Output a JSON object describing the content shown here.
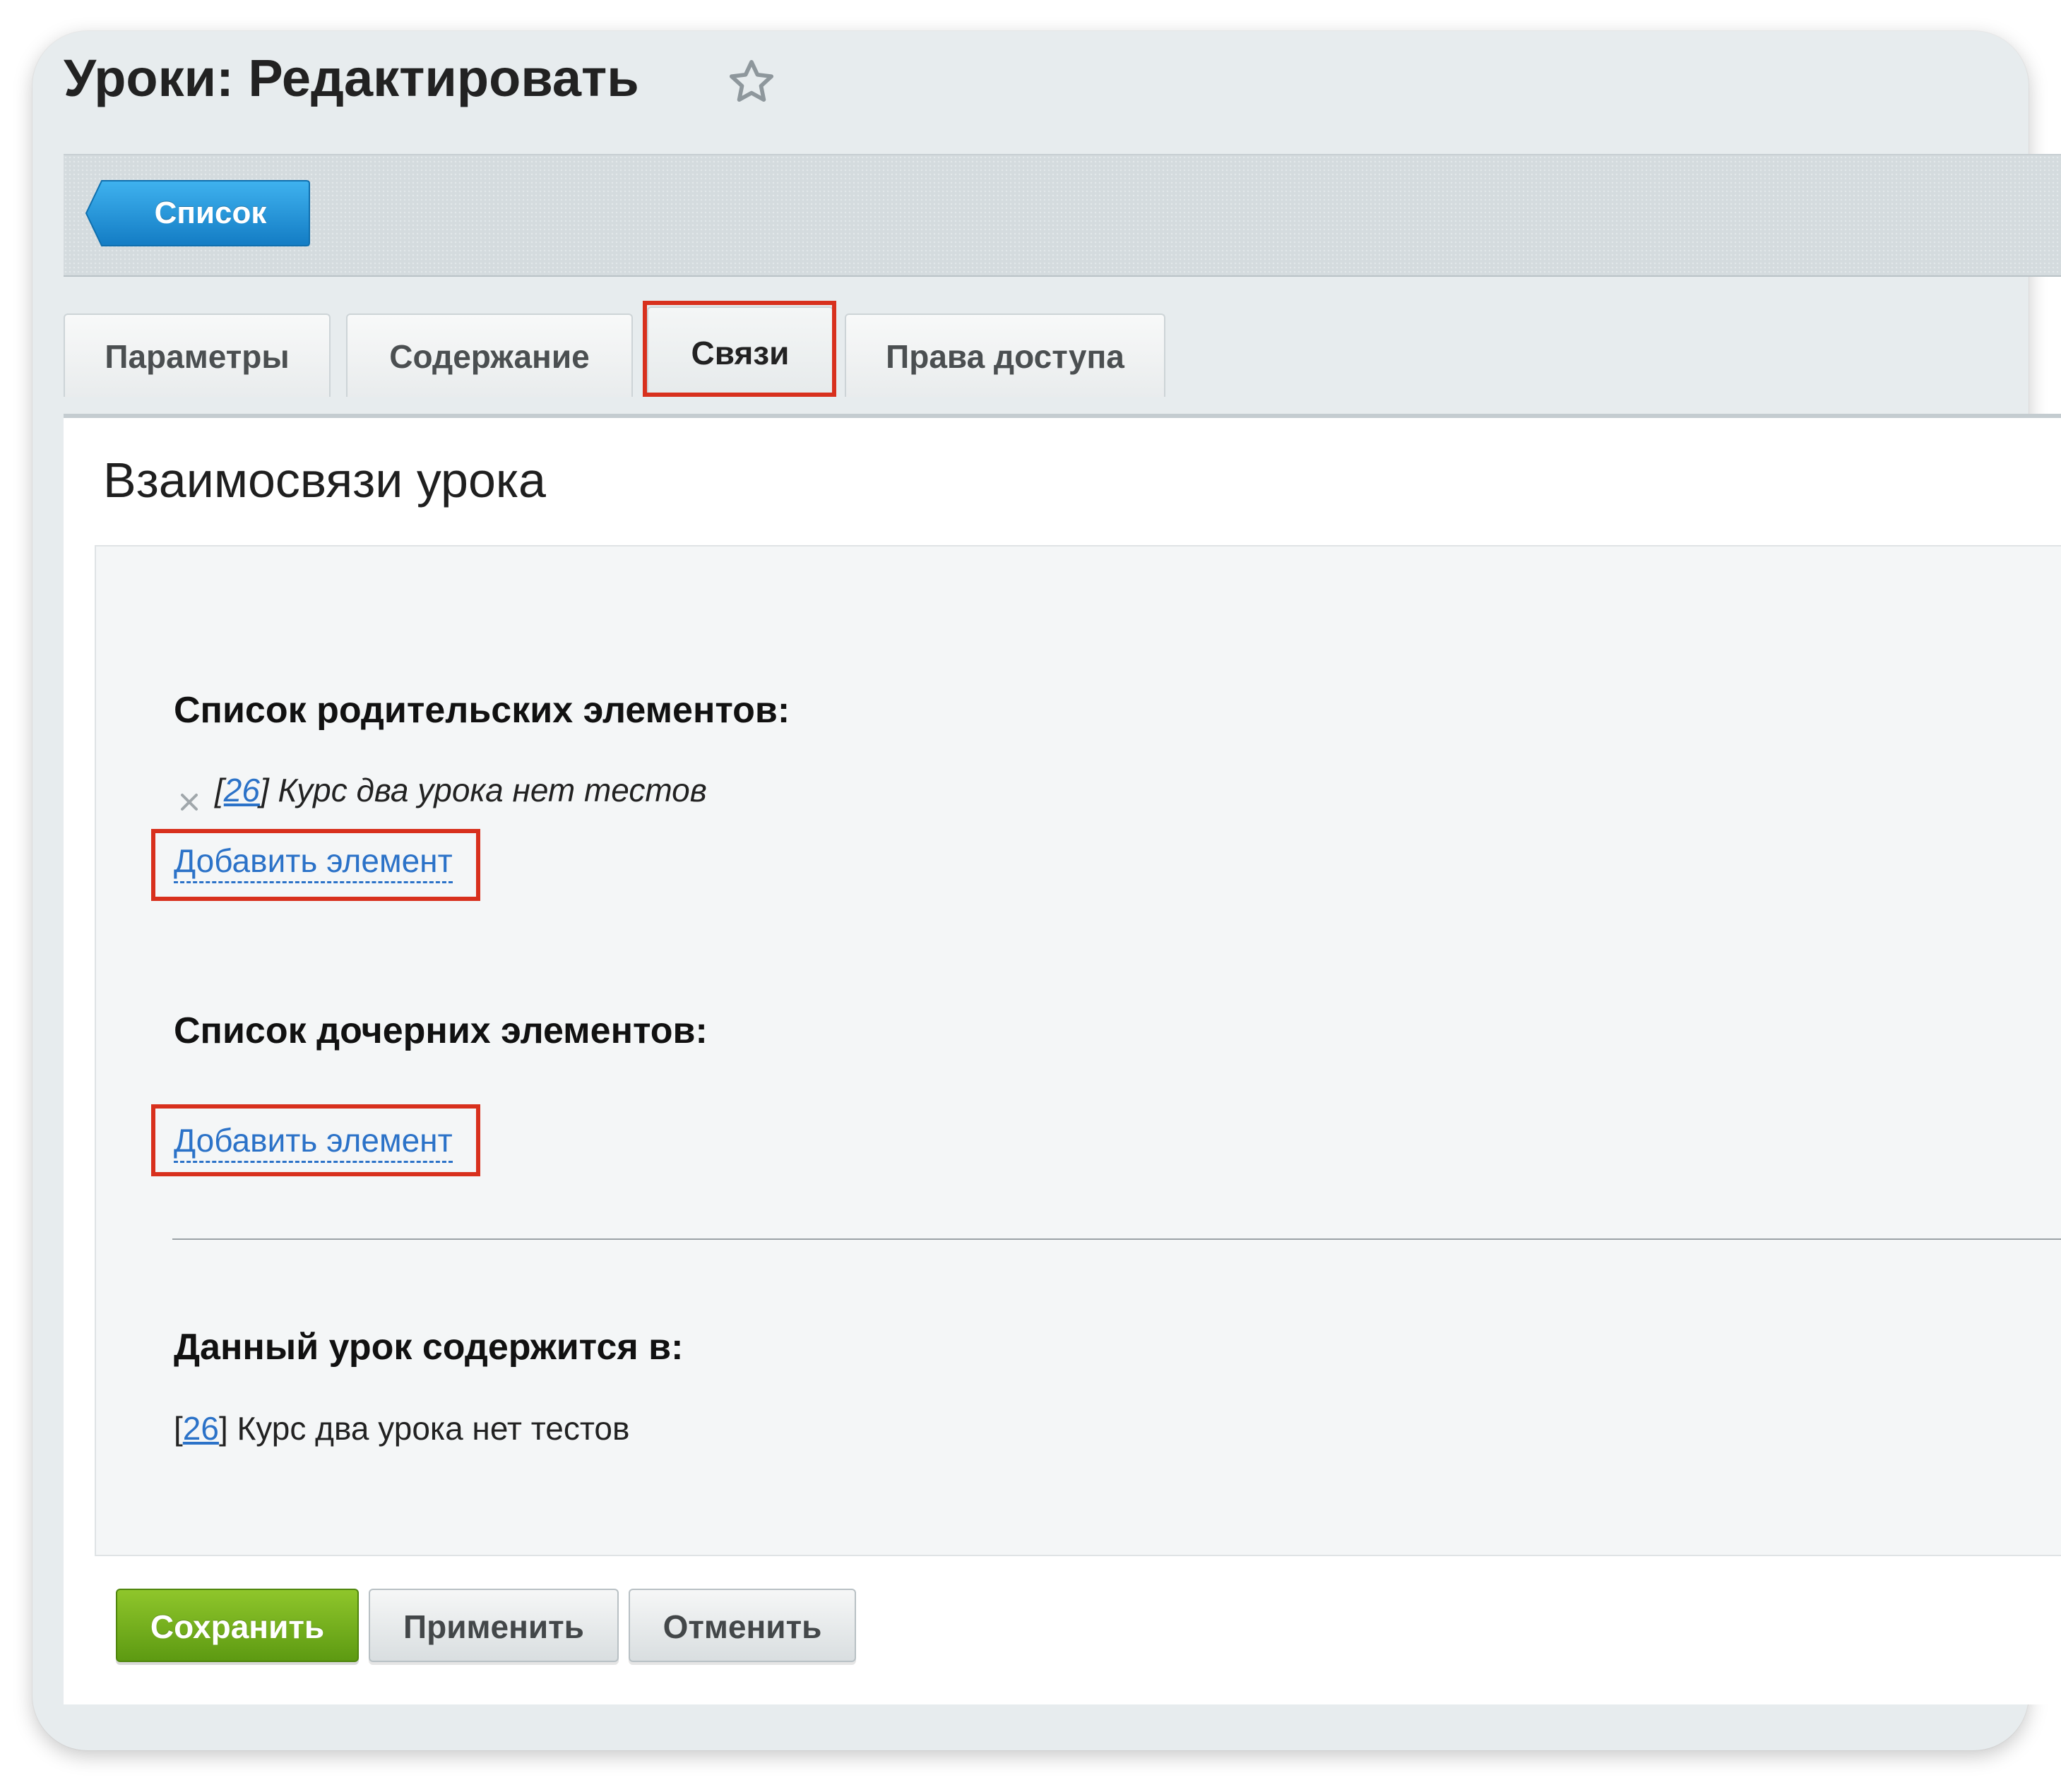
{
  "page": {
    "title": "Уроки: Редактировать",
    "star_icon": "star-icon"
  },
  "toolbar": {
    "list_button_label": "Список",
    "accent_color": "#1e9ae0"
  },
  "tabs": [
    {
      "label": "Параметры",
      "active": false
    },
    {
      "label": "Содержание",
      "active": false
    },
    {
      "label": "Связи",
      "active": true,
      "highlighted": true
    },
    {
      "label": "Права доступа",
      "active": false
    }
  ],
  "section": {
    "title": "Взаимосвязи урока"
  },
  "parents": {
    "heading": "Список родительских элементов:",
    "items": [
      {
        "id": "26",
        "name": "Курс два урока нет тестов",
        "remove_icon": "close-icon"
      }
    ],
    "add_link": "Добавить элемент"
  },
  "children": {
    "heading": "Список дочерних элементов:",
    "add_link": "Добавить элемент"
  },
  "contained": {
    "heading": "Данный урок содержится в:",
    "items": [
      {
        "id": "26",
        "name": "Курс два урока нет тестов"
      }
    ]
  },
  "actions": {
    "save": "Сохранить",
    "apply": "Применить",
    "cancel": "Отменить",
    "save_color": "#6aa61a",
    "highlight_color": "#d8301d"
  }
}
